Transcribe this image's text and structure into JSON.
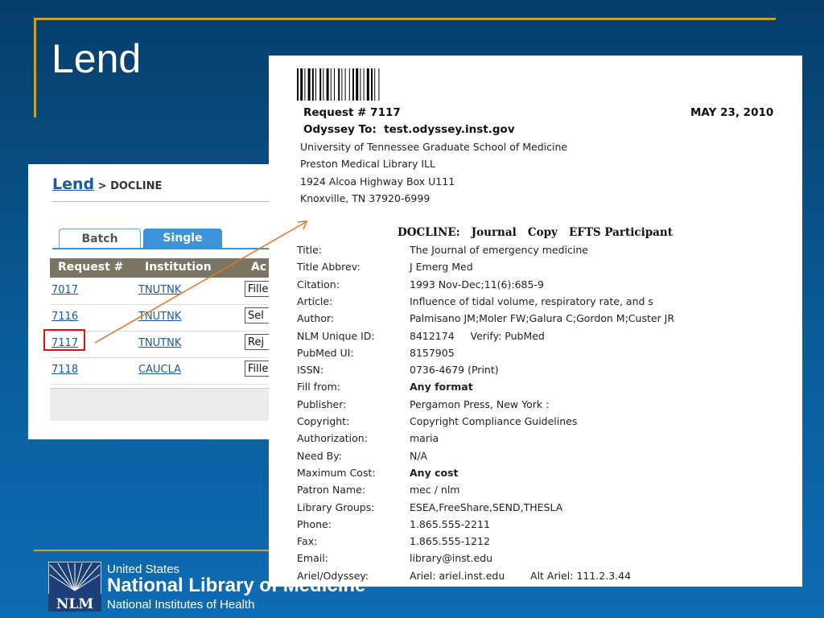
{
  "slide": {
    "title": "Lend"
  },
  "left_panel": {
    "breadcrumb_link": "Lend",
    "breadcrumb_rest": "> DOCLINE",
    "tabs": [
      {
        "label": "Batch"
      },
      {
        "label": "Single"
      }
    ],
    "columns": [
      "Request #",
      "Institution",
      "Ac"
    ],
    "rows": [
      {
        "request": "7017",
        "institution": "TNUTNK",
        "action": "Fille"
      },
      {
        "request": "7116",
        "institution": "TNUTNK",
        "action": "Sel"
      },
      {
        "request": "7117",
        "institution": "TNUTNK",
        "action": "Rej"
      },
      {
        "request": "7118",
        "institution": "CAUCLA",
        "action": "Fille"
      }
    ]
  },
  "document": {
    "request": "Request # 7117",
    "date": "MAY 23, 2010",
    "odyssey_to": "Odyssey To:  test.odyssey.inst.gov",
    "address": [
      "University of Tennessee Graduate School of Medicine",
      "Preston Medical Library ILL",
      "1924 Alcoa Highway Box U111",
      "Knoxville, TN 37920-6999"
    ],
    "docline_line": "DOCLINE:   Journal   Copy   EFTS Participant",
    "fields": [
      {
        "label": "Title:",
        "value": "The Journal of emergency medicine",
        "bold": false
      },
      {
        "label": "Title Abbrev:",
        "value": "J Emerg Med",
        "bold": false
      },
      {
        "label": "Citation:",
        "value": "1993 Nov-Dec;11(6):685-9",
        "bold": false
      },
      {
        "label": "Article:",
        "value": "Influence of tidal volume, respiratory rate, and s",
        "bold": false
      },
      {
        "label": "Author:",
        "value": "Palmisano JM;Moler FW;Galura C;Gordon M;Custer JR",
        "bold": false
      },
      {
        "label": "NLM Unique ID:",
        "value": "8412174     Verify: PubMed",
        "bold": false
      },
      {
        "label": "PubMed UI:",
        "value": "8157905",
        "bold": false
      },
      {
        "label": "ISSN:",
        "value": "0736-4679 (Print)",
        "bold": false
      },
      {
        "label": "Fill from:",
        "value": "Any format",
        "bold": true
      },
      {
        "label": "Publisher:",
        "value": "Pergamon Press, New York :",
        "bold": false
      },
      {
        "label": "Copyright:",
        "value": "Copyright Compliance Guidelines",
        "bold": false
      },
      {
        "label": "Authorization:",
        "value": "maria",
        "bold": false
      },
      {
        "label": "Need By:",
        "value": "N/A",
        "bold": false
      },
      {
        "label": "Maximum Cost:",
        "value": "Any cost",
        "bold": true
      },
      {
        "label": "Patron Name:",
        "value": "mec / nlm",
        "bold": false
      },
      {
        "label": "Library Groups:",
        "value": "ESEA,FreeShare,SEND,THESLA",
        "bold": false
      },
      {
        "label": "Phone:",
        "value": "1.865.555-2211",
        "bold": false
      },
      {
        "label": "Fax:",
        "value": "1.865.555-1212",
        "bold": false
      },
      {
        "label": "Email:",
        "value": "library@inst.edu",
        "bold": false
      },
      {
        "label": "Ariel/Odyssey:",
        "value": "Ariel: ariel.inst.edu        Alt Ariel: 111.2.3.44",
        "bold": false
      }
    ]
  },
  "footer": {
    "logo_text": "NLM",
    "line1": "United States",
    "line2": "National Library of Medicine",
    "line3": "National Institutes of Health"
  },
  "colors": {
    "accent_gold": "#c9a227",
    "tab_blue": "#3d93d9",
    "link_blue": "#1a5aa3",
    "highlight_red": "#dd1111"
  }
}
